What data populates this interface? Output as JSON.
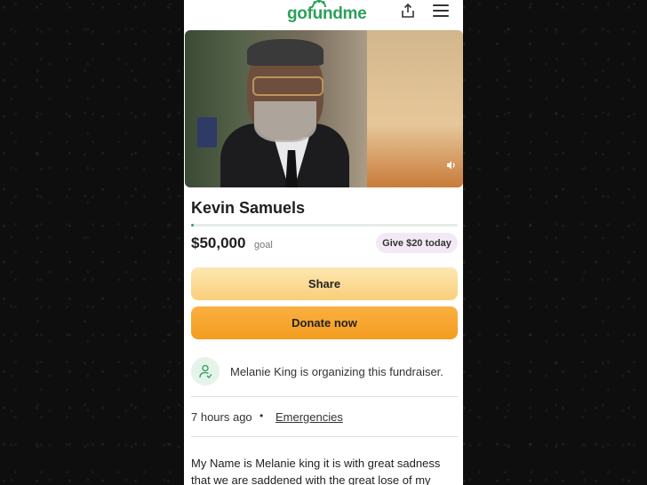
{
  "app": {
    "logo_text": "gofundme",
    "brand_color": "#2ca05a"
  },
  "header": {
    "share_icon": "upload-share-icon",
    "menu_icon": "hamburger-menu-icon"
  },
  "media": {
    "volume_icon": "volume-icon"
  },
  "campaign": {
    "title": "Kevin Samuels",
    "progress_fraction": 0.01,
    "amount": "$50,000",
    "goal_label": "goal",
    "give_badge": "Give $20 today"
  },
  "actions": {
    "share_label": "Share",
    "donate_label": "Donate now",
    "share_color": "#f9cf79",
    "donate_color": "#f39c1f"
  },
  "organizer": {
    "text": "Melanie King is organizing this fundraiser.",
    "icon": "person-heart-icon"
  },
  "meta": {
    "time_ago": "7 hours ago",
    "separator": "•",
    "category": "Emergencies"
  },
  "story": {
    "text": "My Name is Melanie king it is with great sadness that we are saddened with the great lose of my oldest"
  }
}
